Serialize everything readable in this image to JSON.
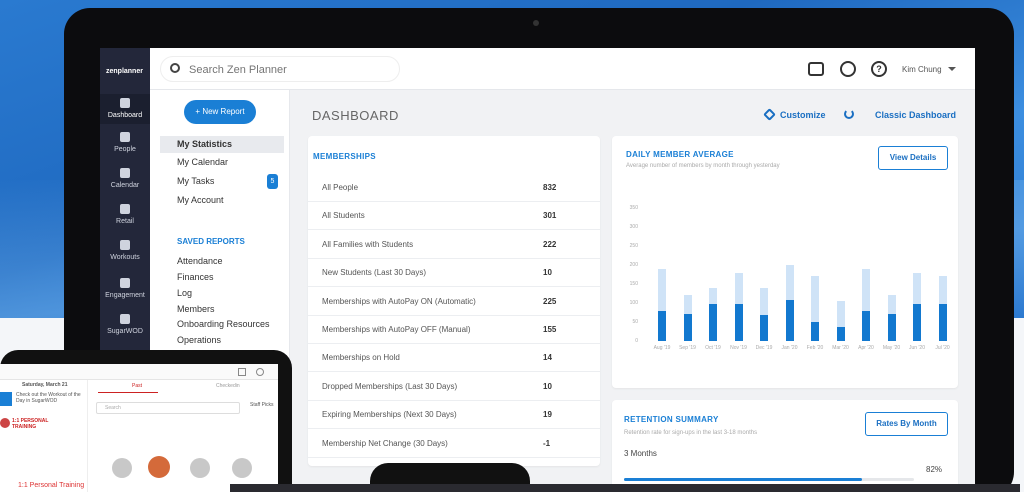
{
  "topbar": {
    "search_placeholder": "Search Zen Planner",
    "user_name": "Kim Chung"
  },
  "logo": "zenplanner",
  "nav": [
    {
      "label": "Dashboard"
    },
    {
      "label": "People"
    },
    {
      "label": "Calendar"
    },
    {
      "label": "Retail"
    },
    {
      "label": "Workouts"
    },
    {
      "label": "Engagement"
    },
    {
      "label": "SugarWOD"
    }
  ],
  "sidebar": {
    "new_report": "+ New Report",
    "links": [
      "My Statistics",
      "My Calendar",
      "My Tasks",
      "My Account"
    ],
    "tasks_badge": "5",
    "saved_heading": "SAVED REPORTS",
    "saved": [
      "Attendance",
      "Finances",
      "Log",
      "Members",
      "Onboarding Resources",
      "Operations"
    ]
  },
  "header": {
    "title": "DASHBOARD",
    "customize": "Customize",
    "classic": "Classic Dashboard"
  },
  "memberships": {
    "title": "MEMBERSHIPS",
    "rows": [
      {
        "label": "All People",
        "value": "832"
      },
      {
        "label": "All Students",
        "value": "301"
      },
      {
        "label": "All Families with Students",
        "value": "222"
      },
      {
        "label": "New Students (Last 30 Days)",
        "value": "10"
      },
      {
        "label": "Memberships with AutoPay ON (Automatic)",
        "value": "225"
      },
      {
        "label": "Memberships with AutoPay OFF (Manual)",
        "value": "155"
      },
      {
        "label": "Memberships on Hold",
        "value": "14"
      },
      {
        "label": "Dropped Memberships (Last 30 Days)",
        "value": "10"
      },
      {
        "label": "Expiring Memberships (Next 30 Days)",
        "value": "19"
      },
      {
        "label": "Membership Net Change (30 Days)",
        "value": "-1"
      }
    ]
  },
  "daily": {
    "title": "DAILY MEMBER AVERAGE",
    "subtitle": "Average number of members by month through yesterday",
    "button": "View Details"
  },
  "chart_data": {
    "type": "bar",
    "title": "DAILY MEMBER AVERAGE",
    "categories": [
      "Aug '19",
      "Sep '19",
      "Oct '19",
      "Nov '19",
      "Dec '19",
      "Jan '20",
      "Feb '20",
      "Mar '20",
      "Apr '20",
      "May '20",
      "Jun '20",
      "Jul '20"
    ],
    "series": [
      {
        "values": [
          190,
          120,
          140,
          180,
          140,
          200,
          170,
          105,
          190,
          120,
          180,
          170
        ]
      },
      {
        "values": [
          80,
          72,
          98,
          98,
          68,
          108,
          50,
          38,
          80,
          72,
          98,
          98
        ]
      }
    ],
    "yticks": [
      "350",
      "300",
      "250",
      "200",
      "150",
      "100",
      "50",
      "0"
    ],
    "ylim": [
      0,
      350
    ],
    "grid": false
  },
  "retention": {
    "title": "RETENTION SUMMARY",
    "subtitle": "Retention rate for sign-ups in the last 3-18 months",
    "button": "Rates By Month",
    "period": "3 Months",
    "percent": "82%",
    "fraction": 0.82
  },
  "phone": {
    "date": "Saturday, March 21",
    "tab_left": "Past",
    "tab_right": "Checkedin",
    "notice": "Check out the Workout of the Day in SugarWOD",
    "class_name": "1:1 PERSONAL TRAINING",
    "search": "Search",
    "people_label": "Staff Picks",
    "footer_class": "1:1 Personal Training"
  }
}
